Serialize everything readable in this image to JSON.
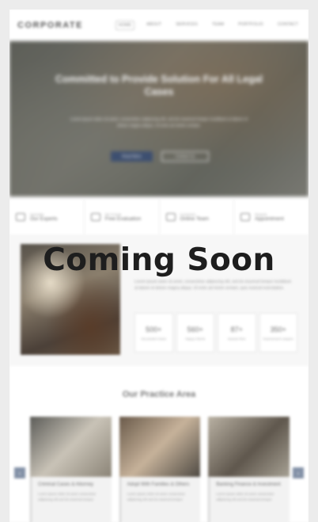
{
  "header": {
    "logo": "CORPORATE",
    "nav": [
      "HOME",
      "ABOUT",
      "SERVICES",
      "TEAM",
      "PORTFOLIO",
      "CONTACT"
    ]
  },
  "hero": {
    "title": "Committed to Provide Solution For All Legal Cases",
    "text": "Lorem ipsum dolor sit amet, consectetur adipiscing elit, sed do eiusmod tempor incididunt ut labore et dolore magna aliqua. Ut enim ad minim veniam.",
    "primary_button": "Read More",
    "secondary_button": "Contact Us"
  },
  "info_bar": [
    {
      "small": "Specialist",
      "big": "Our Experts",
      "icon": "briefcase-icon"
    },
    {
      "small": "We Provide",
      "big": "Free Evaluation",
      "icon": "document-icon"
    },
    {
      "small": "Connected",
      "big": "Online Team",
      "icon": "people-icon"
    },
    {
      "small": "Request",
      "big": "Appointment",
      "icon": "calendar-icon"
    }
  ],
  "about": {
    "text": "Lorem ipsum dolor sit amet, consectetur adipiscing elit, sed do eiusmod tempor incididunt ut labore et dolore magna aliqua. Ut enim ad minim veniam, quis nostrud exercitation.",
    "stats": [
      {
        "number": "500+",
        "label": "Successful Cases"
      },
      {
        "number": "560+",
        "label": "Happy Clients"
      },
      {
        "number": "87+",
        "label": "Awards Won"
      },
      {
        "number": "350+",
        "label": "Experienced Lawyers"
      }
    ]
  },
  "practice": {
    "title": "Our Practice Area",
    "cards": [
      {
        "title": "Criminal Cases & Attorney",
        "text": "Lorem ipsum dolor sit amet consectetur adipiscing elit sed do eiusmod tempor."
      },
      {
        "title": "Adopt With Families & Others",
        "text": "Lorem ipsum dolor sit amet consectetur adipiscing elit sed do eiusmod tempor."
      },
      {
        "title": "Banking Finance & Investment",
        "text": "Lorem ipsum dolor sit amet consectetur adipiscing elit sed do eiusmod tempor."
      }
    ],
    "prev_arrow": "‹",
    "next_arrow": "›"
  },
  "overlay": {
    "text": "Coming Soon"
  }
}
